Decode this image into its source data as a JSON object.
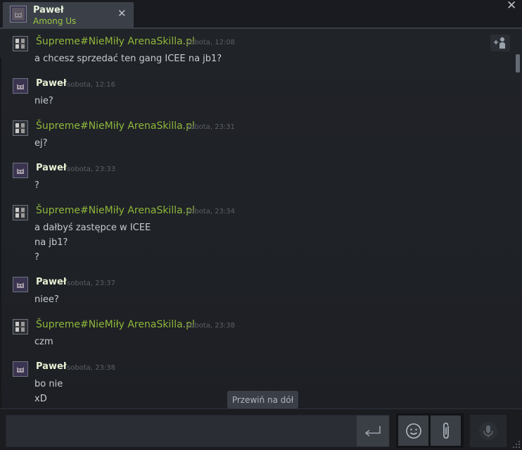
{
  "window": {
    "close_icon": "close-icon",
    "tab": {
      "name": "Paweł",
      "game": "Among Us",
      "close_label": "✕"
    },
    "close_label": "✕"
  },
  "chat": {
    "add_friend_icon": "add-user-icon",
    "messages": [
      {
        "sender": "Šupreme#NieMiły ArenaSkilla.pl",
        "time": "sobota, 12:08",
        "lines": [
          "a chcesz sprzedać ten gang ICEE na jb1?"
        ]
      },
      {
        "sender": "Paweł",
        "time": "sobota, 12:16",
        "lines": [
          "nie?"
        ]
      },
      {
        "sender": "Šupreme#NieMiły ArenaSkilla.pl",
        "time": "sobota, 23:31",
        "lines": [
          "ej?"
        ]
      },
      {
        "sender": "Paweł",
        "time": "sobota, 23:33",
        "lines": [
          "?"
        ]
      },
      {
        "sender": "Šupreme#NieMiły ArenaSkilla.pl",
        "time": "sobota, 23:34",
        "lines": [
          "a dałbyś zastępce w ICEE",
          "na jb1?",
          "?"
        ]
      },
      {
        "sender": "Paweł",
        "time": "sobota, 23:37",
        "lines": [
          "niee?"
        ]
      },
      {
        "sender": "Šupreme#NieMiły ArenaSkilla.pl",
        "time": "sobota, 23:38",
        "lines": [
          "czm"
        ]
      },
      {
        "sender": "Paweł",
        "time": "sobota, 23:38",
        "lines": [
          "bo nie",
          "xD"
        ]
      }
    ],
    "scroll_to_bottom": "Przewiń na dół"
  },
  "composer": {
    "placeholder": "",
    "send_icon": "send-icon",
    "emoji_icon": "emoji-icon",
    "attach_icon": "paperclip-icon",
    "mic_icon": "microphone-icon"
  },
  "colors": {
    "friend_green": "#8fb73a",
    "self_name": "#e6f0d2",
    "background": "#1e2025"
  }
}
